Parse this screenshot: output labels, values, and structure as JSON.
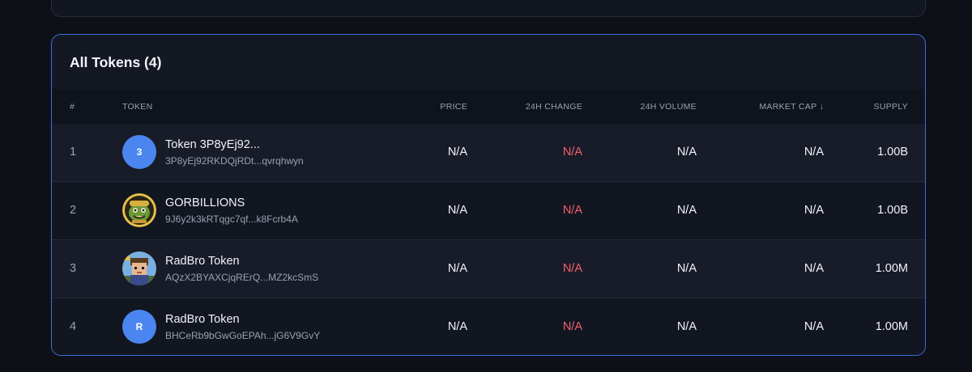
{
  "section": {
    "title": "All Tokens (4)"
  },
  "table": {
    "headers": {
      "num": "#",
      "token": "TOKEN",
      "price": "PRICE",
      "change": "24H CHANGE",
      "volume": "24H VOLUME",
      "market_cap": "MARKET CAP ↓",
      "supply": "SUPPLY"
    },
    "rows": [
      {
        "num": "1",
        "avatar_type": "letter",
        "avatar_letter": "3",
        "name": "Token 3P8yEj92...",
        "address": "3P8yEj92RKDQjRDt...qvrqhwyn",
        "price": "N/A",
        "change": "N/A",
        "volume": "N/A",
        "market_cap": "N/A",
        "supply": "1.00B"
      },
      {
        "num": "2",
        "avatar_type": "image",
        "avatar_icon": "goblin-logo-icon",
        "name": "GORBILLIONS",
        "address": "9J6y2k3kRTqgc7qf...k8Fcrb4A",
        "price": "N/A",
        "change": "N/A",
        "volume": "N/A",
        "market_cap": "N/A",
        "supply": "1.00B"
      },
      {
        "num": "3",
        "avatar_type": "image",
        "avatar_icon": "pixel-character-icon",
        "name": "RadBro Token",
        "address": "AQzX2BYAXCjqRErQ...MZ2kcSmS",
        "price": "N/A",
        "change": "N/A",
        "volume": "N/A",
        "market_cap": "N/A",
        "supply": "1.00M"
      },
      {
        "num": "4",
        "avatar_type": "letter",
        "avatar_letter": "R",
        "name": "RadBro Token",
        "address": "BHCeRb9bGwGoEPAh...jG6V9GvY",
        "price": "N/A",
        "change": "N/A",
        "volume": "N/A",
        "market_cap": "N/A",
        "supply": "1.00M"
      }
    ]
  },
  "colors": {
    "accent_border": "#3b6fd8",
    "letter_avatar": "#4b86f0",
    "negative_change": "#f0616d"
  }
}
